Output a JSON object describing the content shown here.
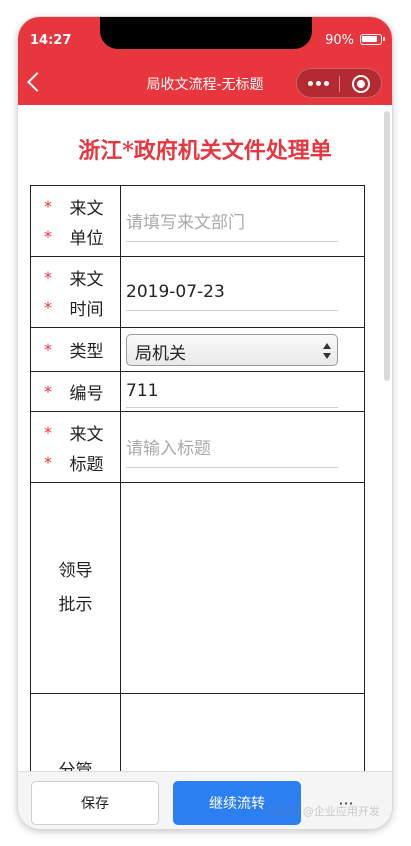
{
  "status_bar": {
    "time": "14:27",
    "battery": "90%"
  },
  "nav": {
    "title": "局收文流程-无标题"
  },
  "document": {
    "title": "浙江*政府机关文件处理单"
  },
  "form": {
    "required_mark": "*",
    "unit": {
      "label_1": "来文",
      "label_2": "单位",
      "placeholder": "请填写来文部门"
    },
    "time": {
      "label_1": "来文",
      "label_2": "时间",
      "value": "2019-07-23"
    },
    "type": {
      "label": "类型",
      "value": "局机关"
    },
    "number": {
      "label": "编号",
      "value": "711"
    },
    "subject": {
      "label_1": "来文",
      "label_2": "标题",
      "placeholder": "请输入标题"
    },
    "instructions": {
      "label_1": "领导",
      "label_2": "批示"
    },
    "charge": {
      "label_1": "分管"
    }
  },
  "actions": {
    "save": "保存",
    "continue": "继续流转",
    "more": "···"
  },
  "watermark": "CSDN @企业应用开发"
}
